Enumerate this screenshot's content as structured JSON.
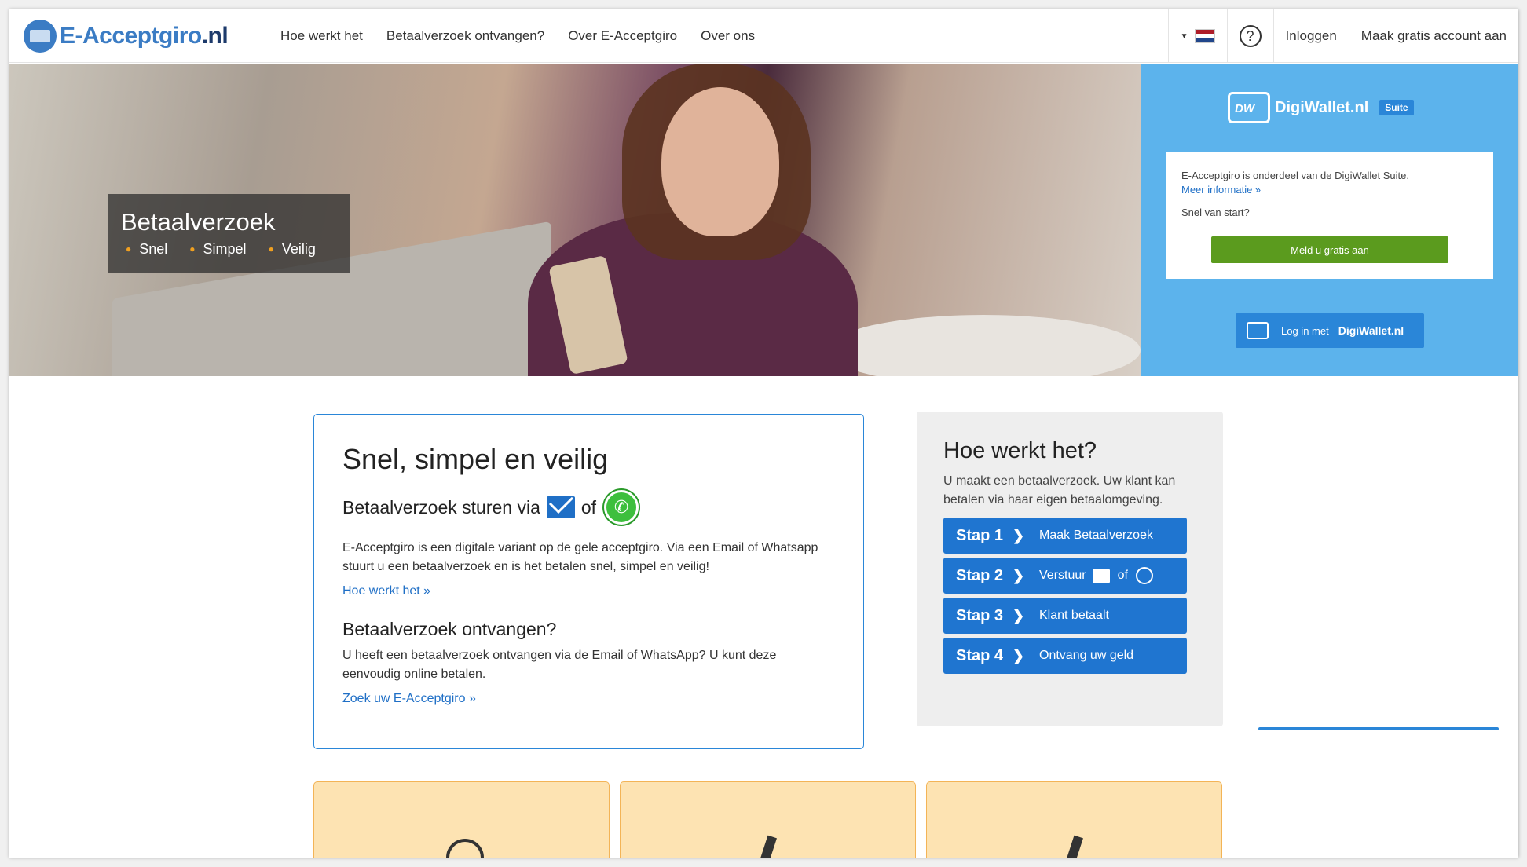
{
  "header": {
    "logo": {
      "main": "E-Acceptgiro",
      "suffix": ".nl"
    },
    "nav": [
      "Hoe werkt het",
      "Betaalverzoek ontvangen?",
      "Over E-Acceptgiro",
      "Over ons"
    ],
    "help_label": "?",
    "login": "Inloggen",
    "signup": "Maak gratis account aan",
    "language_flag_colors": [
      "#ae1c28",
      "#ffffff",
      "#21468b"
    ]
  },
  "hero": {
    "title": "Betaalverzoek",
    "bullets": [
      "Snel",
      "Simpel",
      "Veilig"
    ]
  },
  "digiwallet": {
    "brand": "DigiWallet.nl",
    "suite": "Suite",
    "text": "E-Acceptgiro is onderdeel van de DigiWallet Suite.",
    "more_link": "Meer informatie »",
    "snel": "Snel van start?",
    "cta": "Meld u gratis aan",
    "login_prefix": "Log in met",
    "login_brand": "DigiWallet.nl"
  },
  "main": {
    "title": "Snel, simpel en veilig",
    "send_heading": "Betaalverzoek sturen via",
    "send_of": "of",
    "send_text": "E-Acceptgiro is een digitale variant op de gele acceptgiro. Via een Email of Whatsapp stuurt u een betaalverzoek en is het betalen snel, simpel en veilig!",
    "how_link": "Hoe werkt het »",
    "receive_heading": "Betaalverzoek ontvangen?",
    "receive_text": "U heeft een betaalverzoek ontvangen via de Email of WhatsApp? U kunt deze eenvoudig online betalen.",
    "search_link": "Zoek uw E-Acceptgiro »"
  },
  "how": {
    "title": "Hoe werkt het?",
    "text": "U maakt een betaalverzoek. Uw klant kan betalen via haar eigen betaalomgeving.",
    "steps": [
      {
        "n": "Stap 1",
        "t": "Maak Betaalverzoek"
      },
      {
        "n": "Stap 2",
        "t": "Verstuur",
        "of": "of"
      },
      {
        "n": "Stap 3",
        "t": "Klant betaalt"
      },
      {
        "n": "Stap 4",
        "t": "Ontvang uw geld"
      }
    ]
  }
}
